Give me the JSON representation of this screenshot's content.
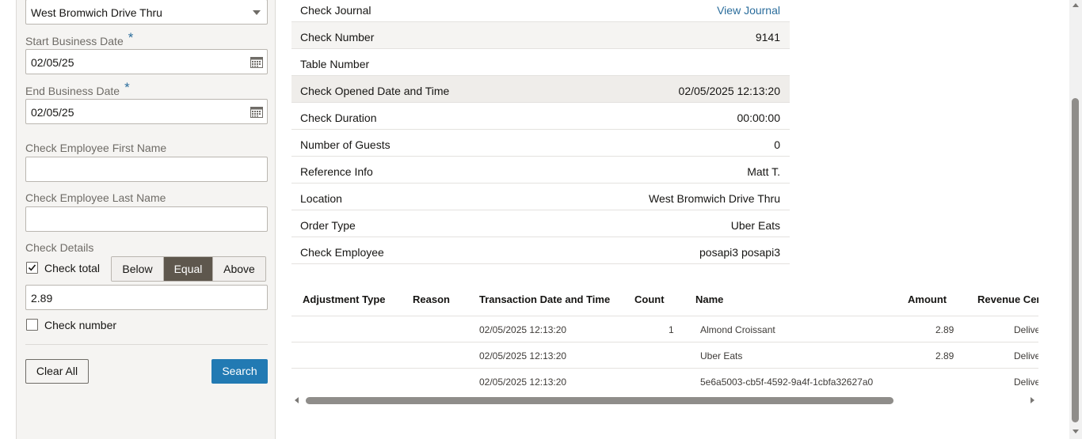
{
  "filters": {
    "location_value": "West Bromwich Drive Thru",
    "start_date_label": "Start Business Date",
    "start_date_value": "02/05/25",
    "end_date_label": "End Business Date",
    "end_date_value": "02/05/25",
    "required_mark": "*",
    "first_name_label": "Check Employee First Name",
    "first_name_value": "",
    "last_name_label": "Check Employee Last Name",
    "last_name_value": "",
    "check_details_label": "Check Details",
    "check_total_label": "Check total",
    "check_total_checked": true,
    "compare_options": [
      "Below",
      "Equal",
      "Above"
    ],
    "compare_selected": "Equal",
    "check_total_value": "2.89",
    "check_number_label": "Check number",
    "check_number_checked": false,
    "clear_label": "Clear All",
    "search_label": "Search"
  },
  "details": [
    {
      "label": "Check Journal",
      "value": "View Journal",
      "link": true
    },
    {
      "label": "Check Number",
      "value": "9141"
    },
    {
      "label": "Table Number",
      "value": ""
    },
    {
      "label": "Check Opened Date and Time",
      "value": "02/05/2025 12:13:20"
    },
    {
      "label": "Check Duration",
      "value": "00:00:00"
    },
    {
      "label": "Number of Guests",
      "value": "0"
    },
    {
      "label": "Reference Info",
      "value": "Matt T."
    },
    {
      "label": "Location",
      "value": "West Bromwich Drive Thru"
    },
    {
      "label": "Order Type",
      "value": "Uber Eats"
    },
    {
      "label": "Check Employee",
      "value": "posapi3 posapi3"
    }
  ],
  "table": {
    "columns": [
      "Adjustment Type",
      "Reason",
      "Transaction Date and Time",
      "Count",
      "Name",
      "Amount",
      "Revenue Cent"
    ],
    "rows": [
      [
        "",
        "",
        "02/05/2025 12:13:20",
        "1",
        "Almond Croissant",
        "2.89",
        "Delive"
      ],
      [
        "",
        "",
        "02/05/2025 12:13:20",
        "",
        "Uber Eats",
        "2.89",
        "Delive"
      ],
      [
        "",
        "",
        "02/05/2025 12:13:20",
        "",
        "5e6a5003-cb5f-4592-9a4f-1cbfa32627a0",
        "",
        "Delive"
      ]
    ]
  },
  "colors": {
    "accent": "#227ab3",
    "link": "#2b6d9c",
    "segment_selected": "#5e574d",
    "panel_bg": "#f5f4f2"
  }
}
